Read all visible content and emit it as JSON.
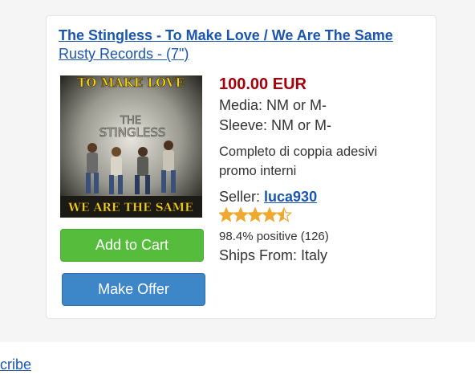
{
  "listing": {
    "title": "The Stingless - To Make Love / We Are The Same",
    "label_format": "Rusty Records - (7\")",
    "cover": {
      "top_text": "TO MAKE LOVE",
      "band_text_1": "THE",
      "band_text_2": "STINGLESS",
      "bottom_text": "WE ARE THE SAME"
    },
    "price": "100.00 EUR",
    "media": "Media: NM or M-",
    "sleeve": "Sleeve: NM or M-",
    "comment": "Completo di coppia adesivi promo interni",
    "seller_prefix": "Seller: ",
    "seller_name": "luca930",
    "rating": 4.5,
    "star_color": "#f0a830",
    "positive": "98.4% positive (126)",
    "ships_from": "Ships From: Italy",
    "add_to_cart": "Add to Cart",
    "make_offer": "Make Offer"
  },
  "footer": {
    "link_text": "cribe"
  },
  "colors": {
    "link": "#1a56b0",
    "price": "#a3000b",
    "cart_button": "#56bd3c",
    "offer_button": "#3d86c8"
  }
}
